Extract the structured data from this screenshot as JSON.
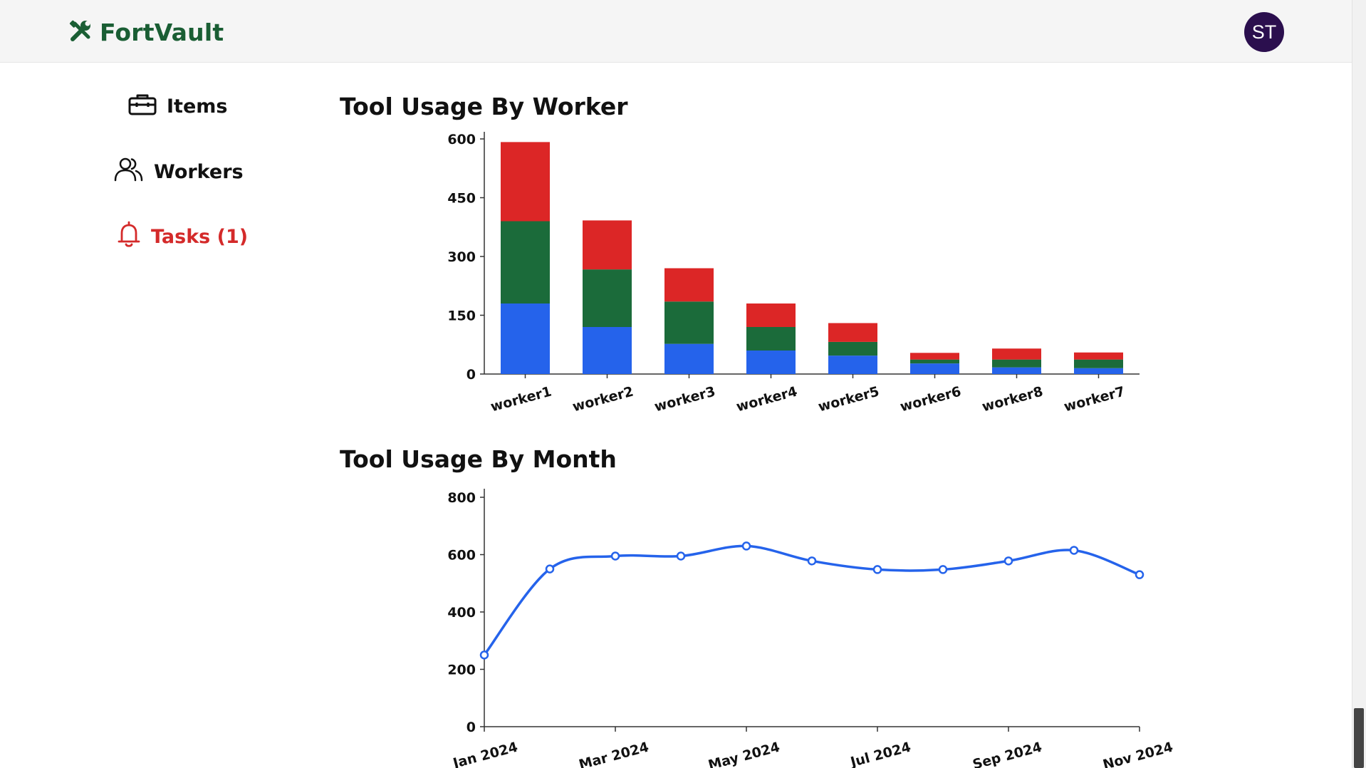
{
  "app": {
    "brand": "FortVault",
    "brand_color": "#1a5e34",
    "avatar_initials": "ST",
    "avatar_color": "#2b0f4e"
  },
  "sidebar": {
    "items": [
      {
        "label": "Items",
        "icon": "toolbox-icon"
      },
      {
        "label": "Workers",
        "icon": "users-icon"
      },
      {
        "label": "Tasks (1)",
        "icon": "bell-icon",
        "color": "#d42a2a"
      }
    ]
  },
  "sections": {
    "worker_title": "Tool Usage By Worker",
    "month_title": "Tool Usage By Month"
  },
  "chart_data": [
    {
      "type": "bar",
      "stacked": true,
      "title": "Tool Usage By Worker",
      "categories": [
        "worker1",
        "worker2",
        "worker3",
        "worker4",
        "worker5",
        "worker6",
        "worker8",
        "worker7"
      ],
      "series": [
        {
          "color": "#2563eb",
          "values": [
            180,
            120,
            77,
            60,
            47,
            27,
            17,
            15
          ]
        },
        {
          "color": "#1b6b3a",
          "values": [
            210,
            147,
            108,
            60,
            35,
            10,
            20,
            22
          ]
        },
        {
          "color": "#dc2626",
          "values": [
            202,
            125,
            85,
            60,
            48,
            17,
            28,
            18
          ]
        }
      ],
      "ylim": [
        0,
        600
      ],
      "yticks": [
        0,
        150,
        300,
        450,
        600
      ],
      "grid": false,
      "legend": "none"
    },
    {
      "type": "line",
      "title": "Tool Usage By Month",
      "x": [
        "Jan 2024",
        "Feb 2024",
        "Mar 2024",
        "Apr 2024",
        "May 2024",
        "Jun 2024",
        "Jul 2024",
        "Aug 2024",
        "Sep 2024",
        "Oct 2024",
        "Nov 2024"
      ],
      "xticks": [
        "Jan 2024",
        "Mar 2024",
        "May 2024",
        "Jul 2024",
        "Sep 2024",
        "Nov 2024"
      ],
      "series": [
        {
          "color": "#2563eb",
          "values": [
            250,
            550,
            595,
            595,
            630,
            578,
            548,
            548,
            578,
            615,
            530
          ]
        }
      ],
      "ylim": [
        0,
        800
      ],
      "yticks": [
        0,
        200,
        400,
        600,
        800
      ],
      "grid": false,
      "legend": "none"
    }
  ]
}
